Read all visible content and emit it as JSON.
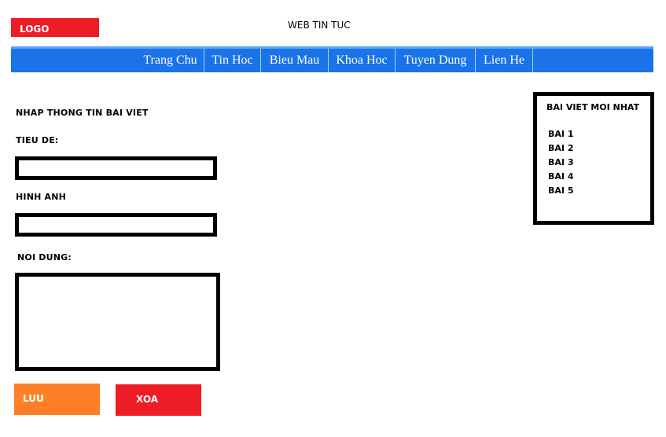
{
  "header": {
    "logo": "LOGO",
    "site_title": "WEB TIN TUC"
  },
  "nav": {
    "items": [
      "Trang Chu",
      "Tin Hoc",
      "Bieu Mau",
      "Khoa Hoc",
      "Tuyen Dung",
      "Lien He"
    ]
  },
  "form": {
    "heading": "NHAP THONG TIN BAI VIET",
    "title_label": "TIEU DE:",
    "title_value": "",
    "image_label": "HINH ANH",
    "image_value": "",
    "content_label": "NOI DUNG:",
    "content_value": "",
    "save_label": "LUU",
    "delete_label": "XOA"
  },
  "sidebar": {
    "title": "BAI VIET MOI NHAT",
    "items": [
      "BAI 1",
      "BAI 2",
      "BAI 3",
      "BAI 4",
      "BAI 5"
    ]
  },
  "colors": {
    "logo_bg": "#ee1c25",
    "nav_bg": "#1a73e8",
    "save_button": "#ff7f27",
    "delete_button": "#ee1c25"
  }
}
